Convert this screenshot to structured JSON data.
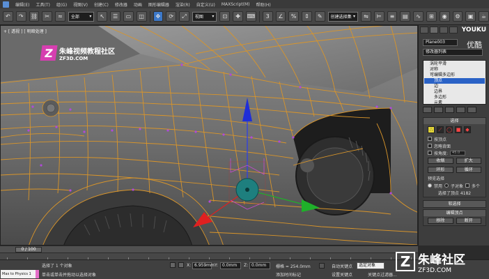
{
  "menubar": {
    "items": [
      "编辑(E)",
      "工具(T)",
      "组(G)",
      "视图(V)",
      "创建(C)",
      "修改器",
      "动画",
      "图形编辑器",
      "渲染(R)",
      "自定义(U)",
      "MAXScript(M)",
      "帮助(H)"
    ]
  },
  "toolbar": {
    "filter_value": "全部",
    "refcoord_value": "视图",
    "selset_value": "创建选择集"
  },
  "viewport": {
    "label": "+ [ 透视 ] [ 明暗处理 ]",
    "watermark_title": "朱峰视频教程社区",
    "watermark_sub": "ZF3D.COM",
    "watermark_letter": "Z"
  },
  "panel": {
    "youku": "YOUKU",
    "youku_cn": "优酷",
    "object_name": "Plane003",
    "modifier_list": "修改器列表",
    "stack": [
      "涡轮平滑",
      "对称",
      "可编辑多边形",
      "顶点",
      "边",
      "边界",
      "多边形",
      "元素"
    ],
    "stack_selected_index": 3,
    "selection_title": "选择",
    "by_vertex": "按顶点",
    "ignore_backfacing": "忽略背面",
    "by_angle": "按角度:",
    "by_angle_value": "45.0",
    "shrink": "收缩",
    "grow": "扩大",
    "ring": "环形",
    "loop": "循环",
    "preview_selection": "预览选择",
    "preview_off": "禁用",
    "preview_subobj": "子对象",
    "preview_multi": "多个",
    "selected_info": "选择了顶点 4182",
    "soft_selection": "软选择",
    "edit_vertices": "编辑顶点",
    "remove": "移除",
    "break": "断开"
  },
  "timeline": {
    "position": "0 / 100",
    "current_frame": 0,
    "total_frames": 100
  },
  "statusbar": {
    "maxscript": "Max to Physics 1",
    "status1": "选择了 1 个对象",
    "status2": "单击或单击并拖动以选择对象",
    "x_label": "X:",
    "x_value": "6.959mm",
    "y_label": "Y:",
    "y_value": "0.0mm",
    "z_label": "Z:",
    "z_value": "0.0mm",
    "grid": "栅格 = 254.0mm",
    "autokey": "自动关键点",
    "selected_obj": "选定对象",
    "set_key": "设置关键点",
    "key_filters": "关键点过滤器...",
    "add_time_tag": "添加时间标记"
  },
  "brand_watermark": {
    "letter": "Z",
    "title": "朱峰社区",
    "sub": "ZF3D.COM"
  },
  "colors": {
    "accent_blue": "#3c78c8",
    "wire_orange": "#d9952a",
    "gizmo_x": "#e02020",
    "gizmo_y": "#1fb02a",
    "gizmo_z": "#1f2ed8",
    "selection_yellow": "#e4d638"
  }
}
